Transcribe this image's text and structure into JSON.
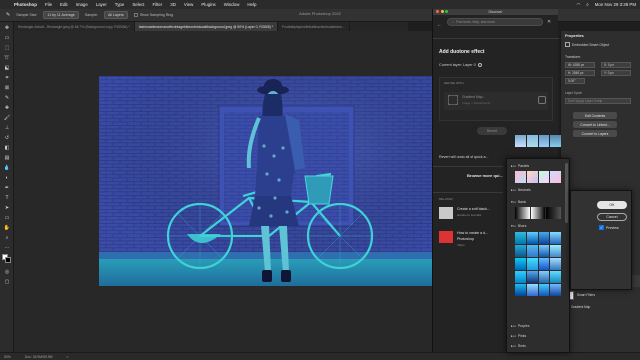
{
  "menubar": {
    "apple": "",
    "app_name": "Photoshop",
    "items": [
      "File",
      "Edit",
      "Image",
      "Layer",
      "Type",
      "Select",
      "Filter",
      "3D",
      "View",
      "Plugins",
      "Window",
      "Help"
    ],
    "clock": "Mon Nov 29  3:39 PM"
  },
  "window_title": "Adobe Photoshop 2022",
  "options": {
    "sample_size_label": "Sample Size:",
    "sample_size_value": "11 by 11 Average",
    "sample_label": "Sample:",
    "sample_value": "All Layers",
    "show_ring": "Show Sampling Ring"
  },
  "tabs": [
    {
      "label": "Rectangle-Ashutt...Rectangle.jpeg @ 66.7% (Background copy, RGB/8#) *",
      "active": false
    },
    {
      "label": "fashionablewomanwithvintagebikeonbrickwallbackground.jpeg @ 50% (Layer 0, RGB/8) *",
      "active": true
    },
    {
      "label": "Footballplayerwithballinactionisolatedon...",
      "active": false
    }
  ],
  "discover": {
    "header": "Discover",
    "search_placeholder": "Find tools, help, and more",
    "title": "Add duotone effect",
    "current_layer": "Current layer: Layer 0",
    "refine_label": "REFINE WITH",
    "refine_item": "Gradient Map...",
    "refine_sub": "Image > Adjustments",
    "revert_button": "Revert",
    "revert_text": "Revert will undo all of quick a...",
    "browse_more": "Browse more qui...",
    "related_label": "RELATED",
    "related": [
      {
        "title": "Create a soft black...",
        "sub": "Hands-on tutorials"
      },
      {
        "title": "How to create a d...",
        "sub2": "Photoshop",
        "sub": "Video"
      }
    ]
  },
  "picker": {
    "groups": [
      "Pastels",
      "Neutrals",
      "Basic",
      "Blues",
      "Purples",
      "Pinks",
      "Reds"
    ]
  },
  "dialog": {
    "ok": "OK",
    "cancel": "Cancel",
    "preview": "Preview"
  },
  "properties": {
    "title": "Properties",
    "subtitle": "Embedded Smart Object",
    "transform": "Transform",
    "w": "W: 4288 px",
    "h": "H: 2848 px",
    "x": "X: 0 px",
    "y": "Y: 0 px",
    "angle": "0.00°",
    "layer_comp": "Layer 0.psb",
    "layer_comp_placeholder": "Don't Apply Layer Comp",
    "edit_contents": "Edit Contents",
    "convert_linked": "Convert to Linked...",
    "convert_layers": "Convert to Layers"
  },
  "layers": {
    "gaussian": "Gaussian Blur",
    "layer0": "Layer 0",
    "smart_filters": "Smart Filters",
    "gradient_map": "Gradient Map"
  },
  "status": {
    "zoom": "50%",
    "info": "Doc: 34.9M/69.9M",
    "arrow": ">"
  },
  "colors": {
    "accent": "#1473e6",
    "photo_wall": "#3c4fae",
    "photo_highlight": "#3ed3d8",
    "panel_dark": "#232323"
  }
}
